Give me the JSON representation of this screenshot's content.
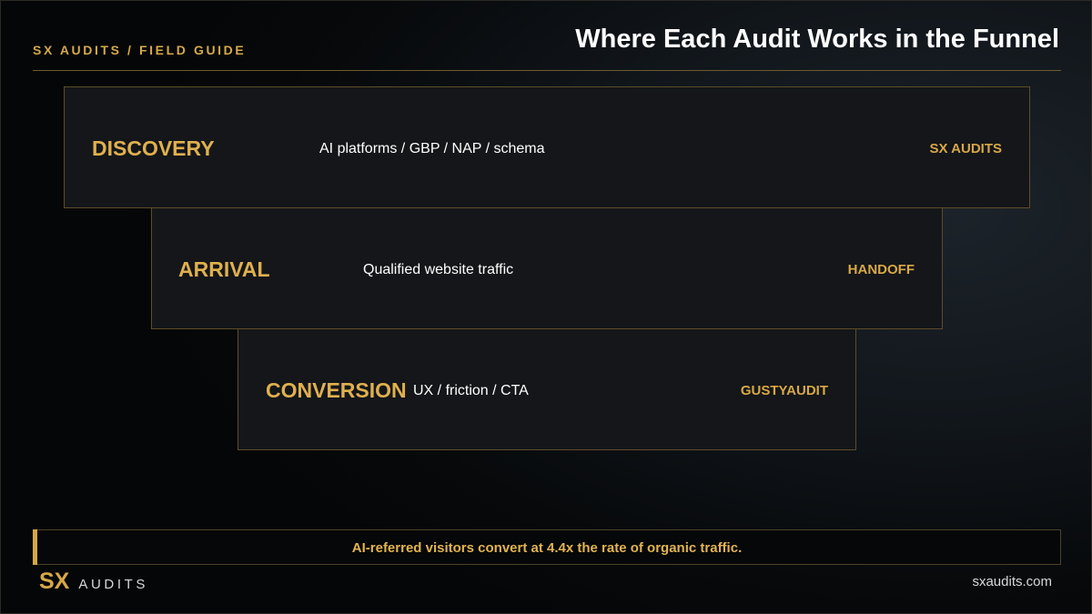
{
  "header": {
    "kicker": "SX AUDITS / FIELD GUIDE",
    "title": "Where Each Audit Works in the Funnel"
  },
  "funnel": {
    "stages": [
      {
        "name": "DISCOVERY",
        "description": "AI platforms / GBP / NAP / schema",
        "tag": "SX AUDITS"
      },
      {
        "name": "ARRIVAL",
        "description": "Qualified website traffic",
        "tag": "HANDOFF"
      },
      {
        "name": "CONVERSION",
        "description": "UX / friction / CTA",
        "tag": "GUSTYAUDIT"
      }
    ]
  },
  "callout": {
    "text": "AI-referred visitors convert at 4.4x the rate of organic traffic."
  },
  "footer": {
    "logo_mark": "SX",
    "logo_word": "AUDITS",
    "url": "sxaudits.com"
  },
  "colors": {
    "accent_gold": "#d8a847",
    "background": "#050607",
    "panel": "#141619",
    "text": "#ffffff"
  }
}
